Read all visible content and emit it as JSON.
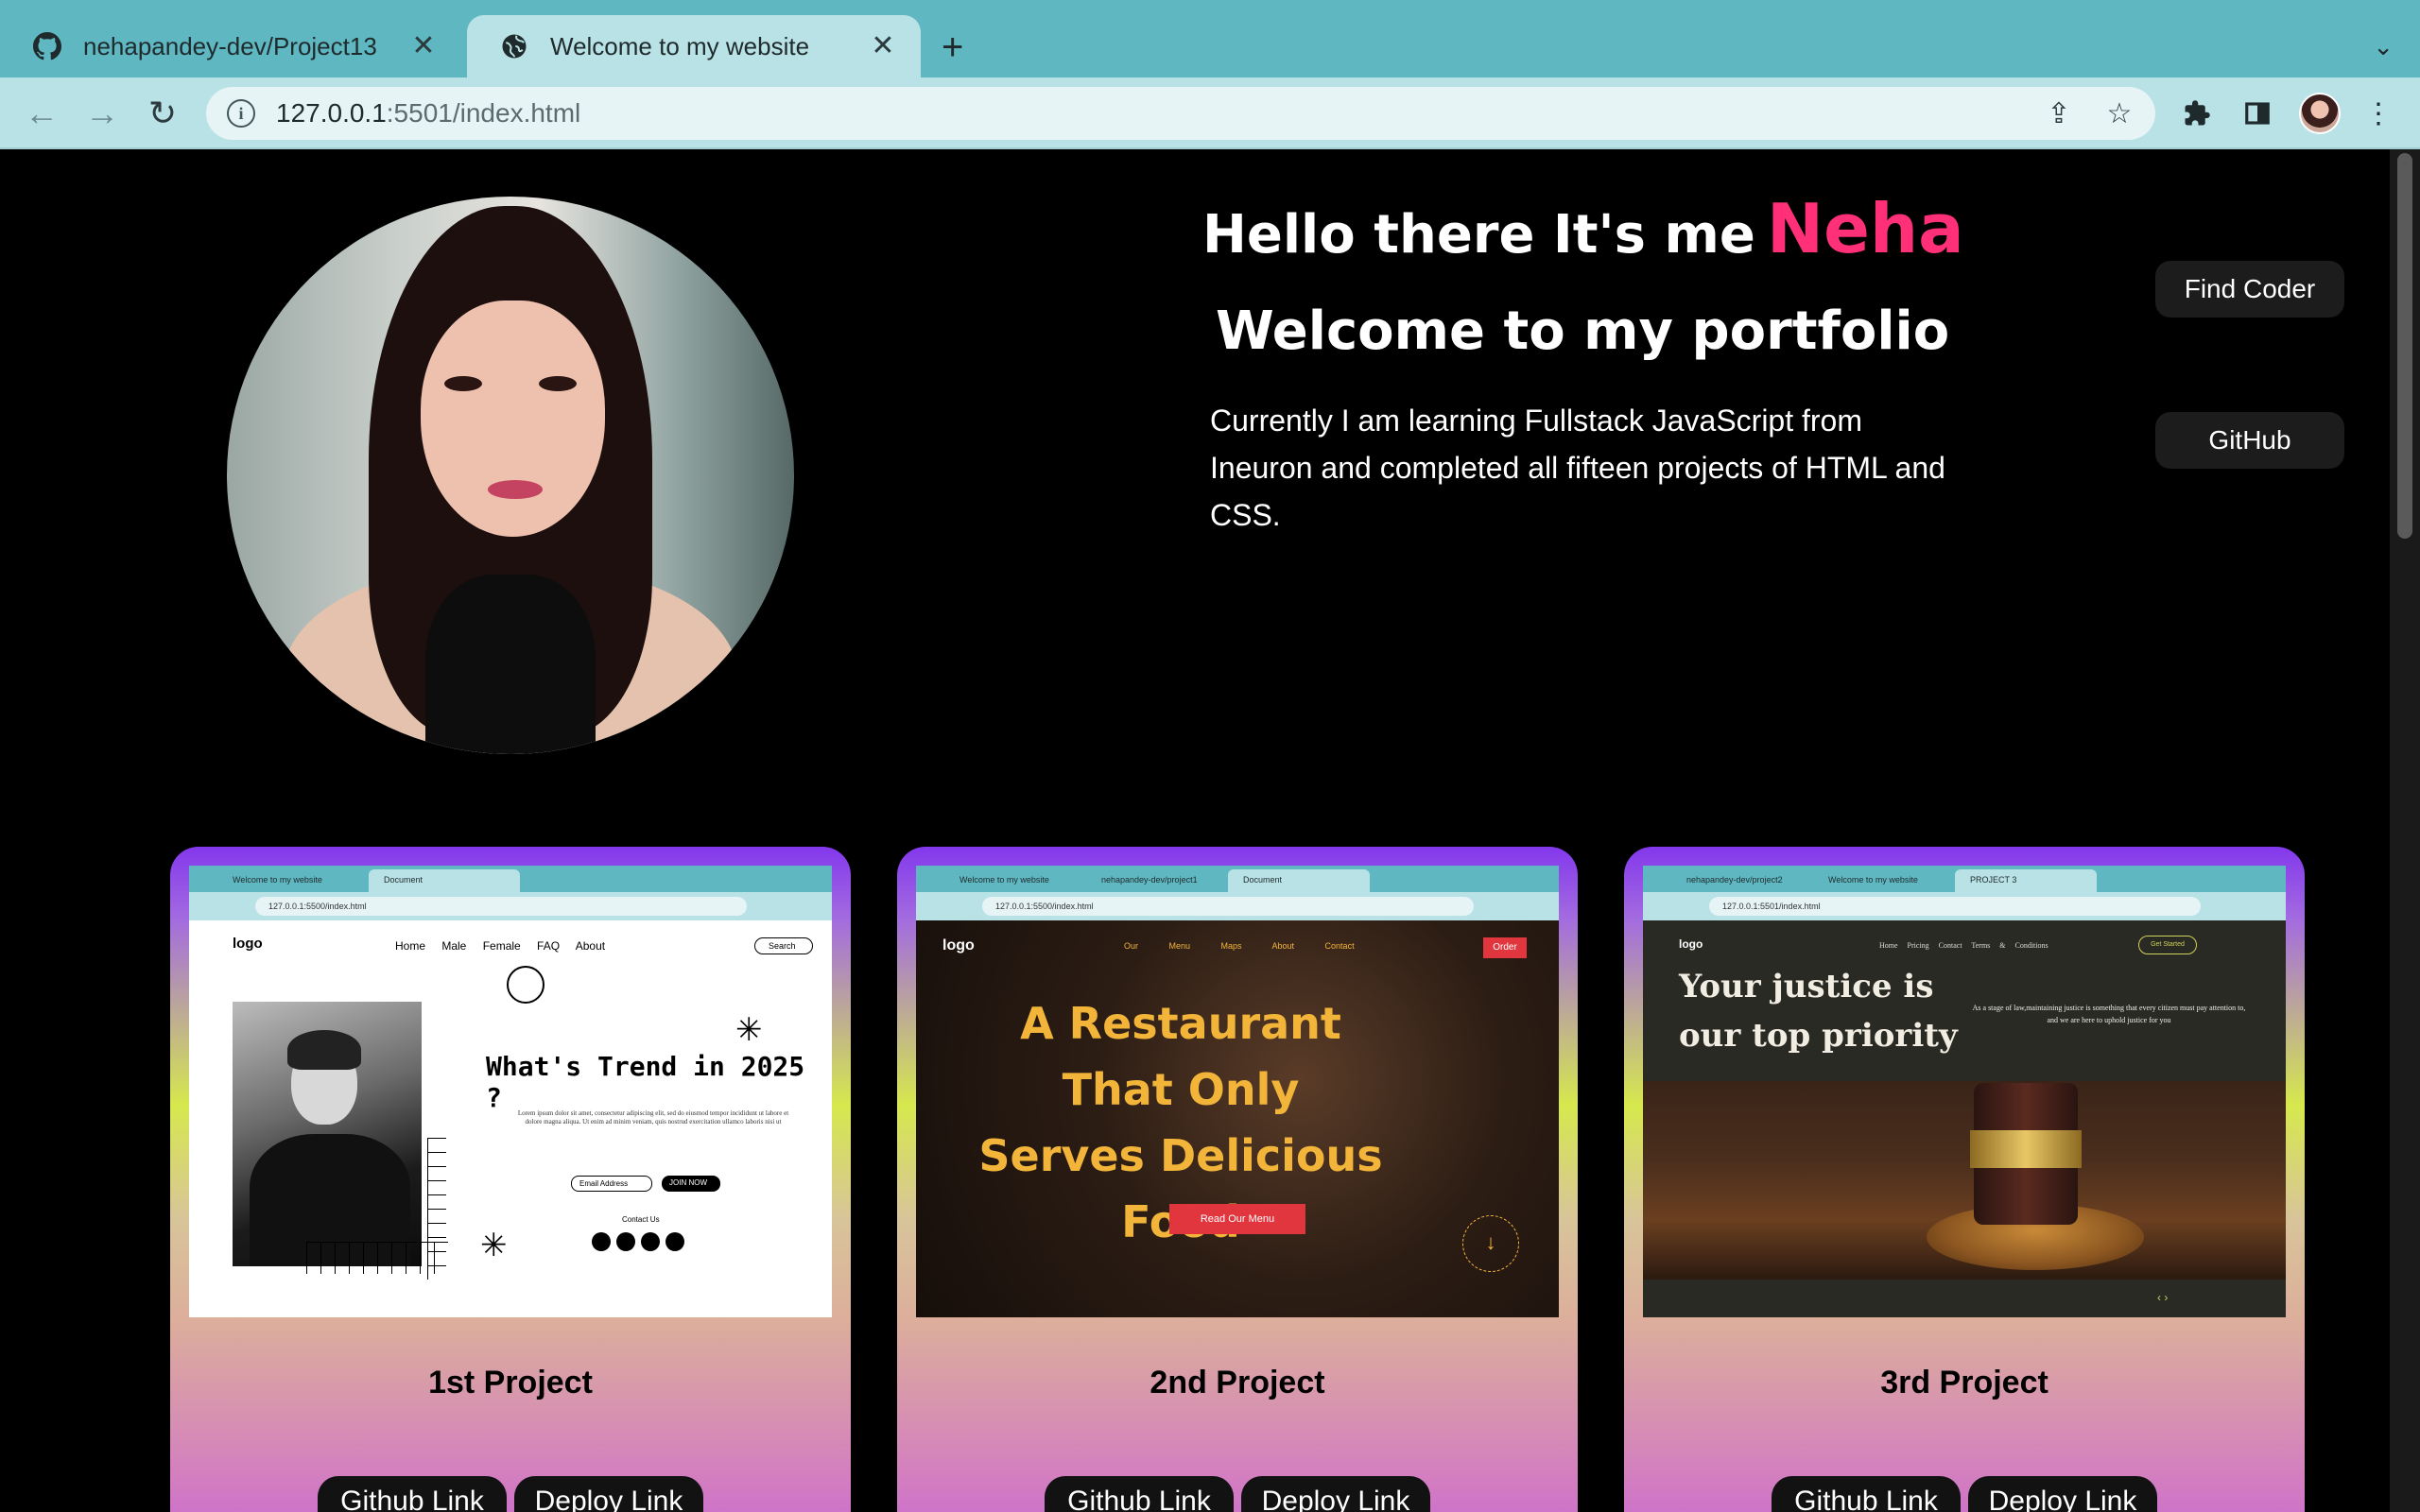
{
  "browser": {
    "tabs": [
      {
        "title": "nehapandey-dev/Project13",
        "icon": "github-icon",
        "active": false
      },
      {
        "title": "Welcome to my website",
        "icon": "globe-icon",
        "active": true
      }
    ],
    "url_host": "127.0.0.1",
    "url_rest": ":5501/index.html"
  },
  "hero": {
    "greeting": "Hello there It's me",
    "name": "Neha",
    "welcome": "Welcome to my portfolio",
    "intro": "Currently I am learning Fullstack JavaScript from Ineuron and completed all fifteen projects of HTML and CSS."
  },
  "side_buttons": {
    "find_coder": "Find Coder",
    "github": "GitHub"
  },
  "projects": [
    {
      "title": "1st Project",
      "github_label": "Github Link",
      "deploy_label": "Deploy Link",
      "shot": {
        "tabs": [
          "Welcome to my website",
          "Document"
        ],
        "url": "127.0.0.1:5500/index.html",
        "logo": "logo",
        "nav": "Home Male Female FAQ About",
        "search": "Search",
        "heading": "What's Trend in 2025 ?",
        "lorem": "Lorem ipsum dolor sit amet, consectetur adipiscing elit, sed do eiusmod tempor incididunt ut labore et dolore magna aliqua. Ut enim ad minim veniam, quis nostrud exercitation ullamco laboris nisi ut",
        "email": "Email Address",
        "join": "JOIN NOW",
        "contact": "Contact Us"
      }
    },
    {
      "title": "2nd Project",
      "github_label": "Github Link",
      "deploy_label": "Deploy Link",
      "shot": {
        "tabs": [
          "Welcome to my website",
          "nehapandey-dev/project1",
          "Document"
        ],
        "url": "127.0.0.1:5500/index.html",
        "logo": "logo",
        "nav": "Our Menu Maps About Contact",
        "order": "Order",
        "heading": "A Restaurant That Only Serves Delicious Food",
        "menu_btn": "Read Our Menu"
      }
    },
    {
      "title": "3rd Project",
      "github_label": "Github Link",
      "deploy_label": "Deploy Link",
      "shot": {
        "tabs": [
          "nehapandey-dev/project2",
          "Welcome to my website",
          "PROJECT 3"
        ],
        "url": "127.0.0.1:5501/index.html",
        "logo": "logo",
        "nav": "Home Pricing Contact Terms & Conditions",
        "cta": "Get Started",
        "heading": "Your justice is our top priority",
        "sub": "As a stage of law,maintaining justice is something that every citizen must pay attention to, and we are here to uphold justice for you"
      }
    }
  ]
}
